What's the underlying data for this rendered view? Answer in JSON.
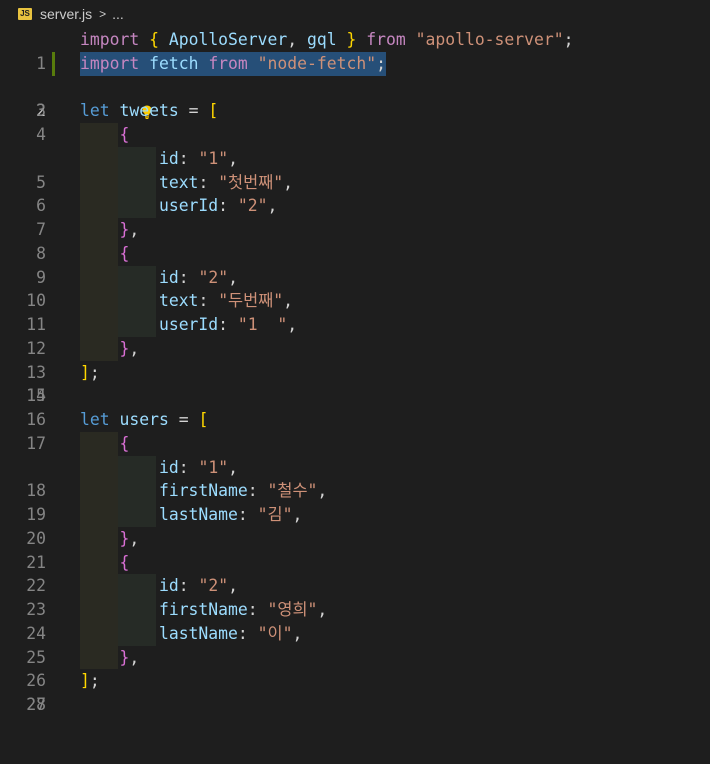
{
  "breadcrumb": {
    "icon_label": "JS",
    "file": "server.js",
    "separator": ">",
    "rest": "..."
  },
  "editor": {
    "active_line": 2,
    "line_numbers": [
      "1",
      "2",
      "3",
      "4",
      "5",
      "6",
      "7",
      "8",
      "9",
      "10",
      "11",
      "12",
      "13",
      "14",
      "15",
      "16",
      "17",
      "18",
      "19",
      "20",
      "21",
      "22",
      "23",
      "24",
      "25",
      "26",
      "27",
      "28"
    ],
    "tokens": {
      "import": "import",
      "from": "from",
      "let": "let",
      "open_brace": "{",
      "close_brace": "}",
      "open_bracket": "[",
      "close_bracket": "]",
      "semicolon": ";",
      "comma": ",",
      "eq": "=",
      "ApolloServer": "ApolloServer",
      "gql": "gql",
      "apollo_server": "\"apollo-server\"",
      "fetch": "fetch",
      "node_fetch": "\"node-fetch\"",
      "tweets": "tweets",
      "users": "users",
      "id_key": "id",
      "text_key": "text",
      "userId_key": "userId",
      "firstName_key": "firstName",
      "lastName_key": "lastName",
      "colon": ":",
      "s1": "\"1\"",
      "s2": "\"2\"",
      "s1_spaced": "\"1  \"",
      "t1": "\"첫번째\"",
      "t2": "\"두번째\"",
      "fn1": "\"철수\"",
      "ln1": "\"김\"",
      "fn2": "\"영희\"",
      "ln2": "\"이\""
    }
  }
}
